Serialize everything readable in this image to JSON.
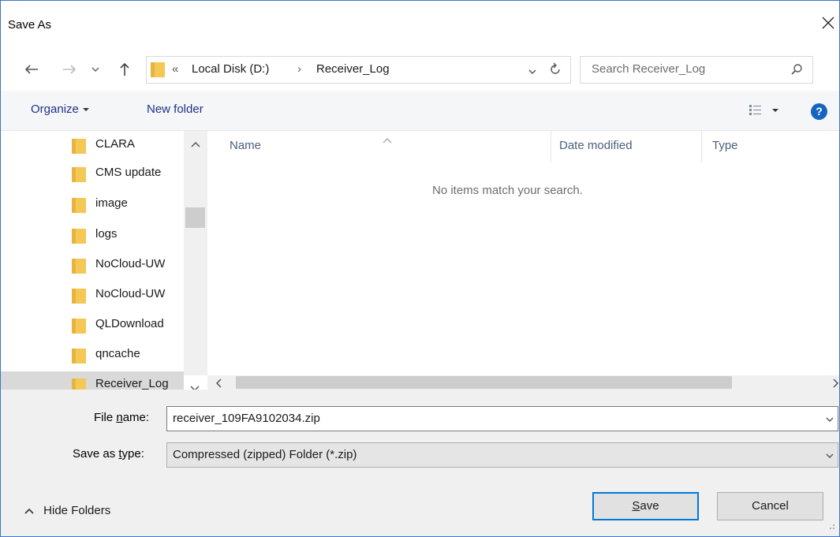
{
  "window": {
    "title": "Save As"
  },
  "address": {
    "overflow_glyph": "«",
    "crumbs": [
      "Local Disk (D:)",
      "Receiver_Log"
    ],
    "separator": "›"
  },
  "search": {
    "placeholder": "Search Receiver_Log"
  },
  "toolbar": {
    "organize_label": "Organize",
    "new_folder_label": "New folder",
    "help_glyph": "?"
  },
  "tree": {
    "items": [
      "CLARA",
      "CMS update",
      "image",
      "logs",
      "NoCloud-UW",
      "NoCloud-UW",
      "QLDownload",
      "qncache",
      "Receiver_Log"
    ],
    "selected_index": 8
  },
  "columns": [
    "Name",
    "Date modified",
    "Type"
  ],
  "content": {
    "empty_message": "No items match your search."
  },
  "form": {
    "file_name_label_pre": "File ",
    "file_name_label_u": "n",
    "file_name_label_post": "ame:",
    "file_name_value": "receiver_109FA9102034.zip",
    "save_type_label_pre": "Save as ",
    "save_type_label_u": "t",
    "save_type_label_post": "ype:",
    "save_type_value": "Compressed (zipped) Folder (*.zip)"
  },
  "footer": {
    "hide_folders_label": "Hide Folders",
    "save_u": "S",
    "save_rest": "ave",
    "cancel_label": "Cancel"
  },
  "colors": {
    "accent": "#0078d7",
    "link_text": "#1e3287",
    "folder": "#f5c754"
  }
}
